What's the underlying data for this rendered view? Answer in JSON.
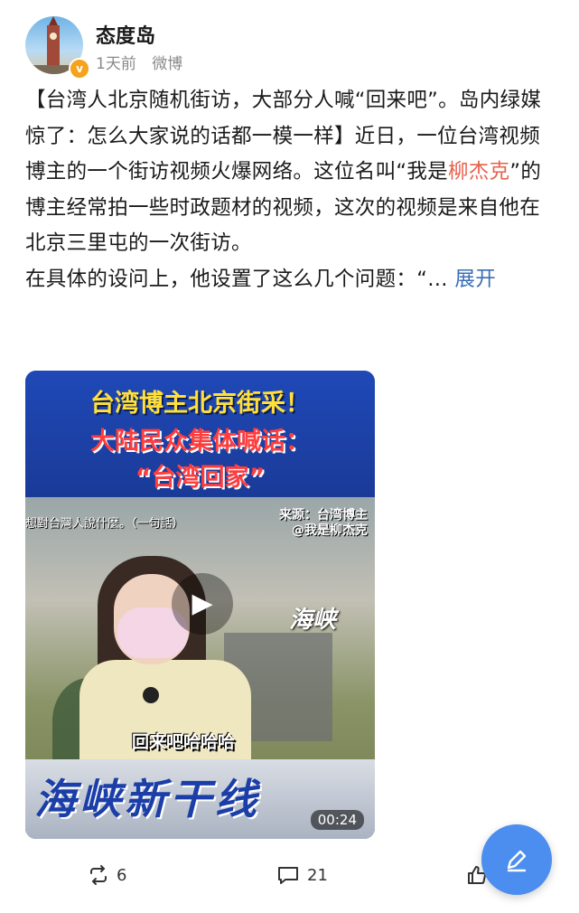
{
  "author": {
    "name": "态度岛",
    "time": "1天前",
    "source": "微博",
    "verified_badge": "v"
  },
  "post": {
    "para1_prefix": "【台湾人北京随机街访，大部分人喊“回来吧”。岛内绿媒惊了：怎么大家说的话都一模一样】近日，一位台湾视频博主的一个街访视频火爆网络。这位名叫“我是",
    "para1_link": "柳杰克",
    "para1_suffix": "”的博主经常拍一些时政题材的视频，这次的视频是来自他在北京三里屯的一次街访。",
    "para2": "在具体的设问上，他设置了这么几个问题：“…",
    "expand_label": "展开"
  },
  "video": {
    "title_line1": "台湾博主北京街采！",
    "title_line2": "大陆民众集体喊话：",
    "title_line3": "“台湾回家”",
    "subtitle_top": "想對台灣人說什麼。（一句話）",
    "source_line1": "来源：台湾博主",
    "source_line2": "@我是柳杰克",
    "logo": "海峡",
    "caption": "回来吧哈哈哈",
    "band_text": "海峡新干线",
    "duration": "00:24"
  },
  "actions": {
    "repost_count": "6",
    "comment_count": "21"
  },
  "colors": {
    "link": "#e8604c",
    "expand": "#3b6fb6",
    "fab": "#4b8ef0"
  }
}
